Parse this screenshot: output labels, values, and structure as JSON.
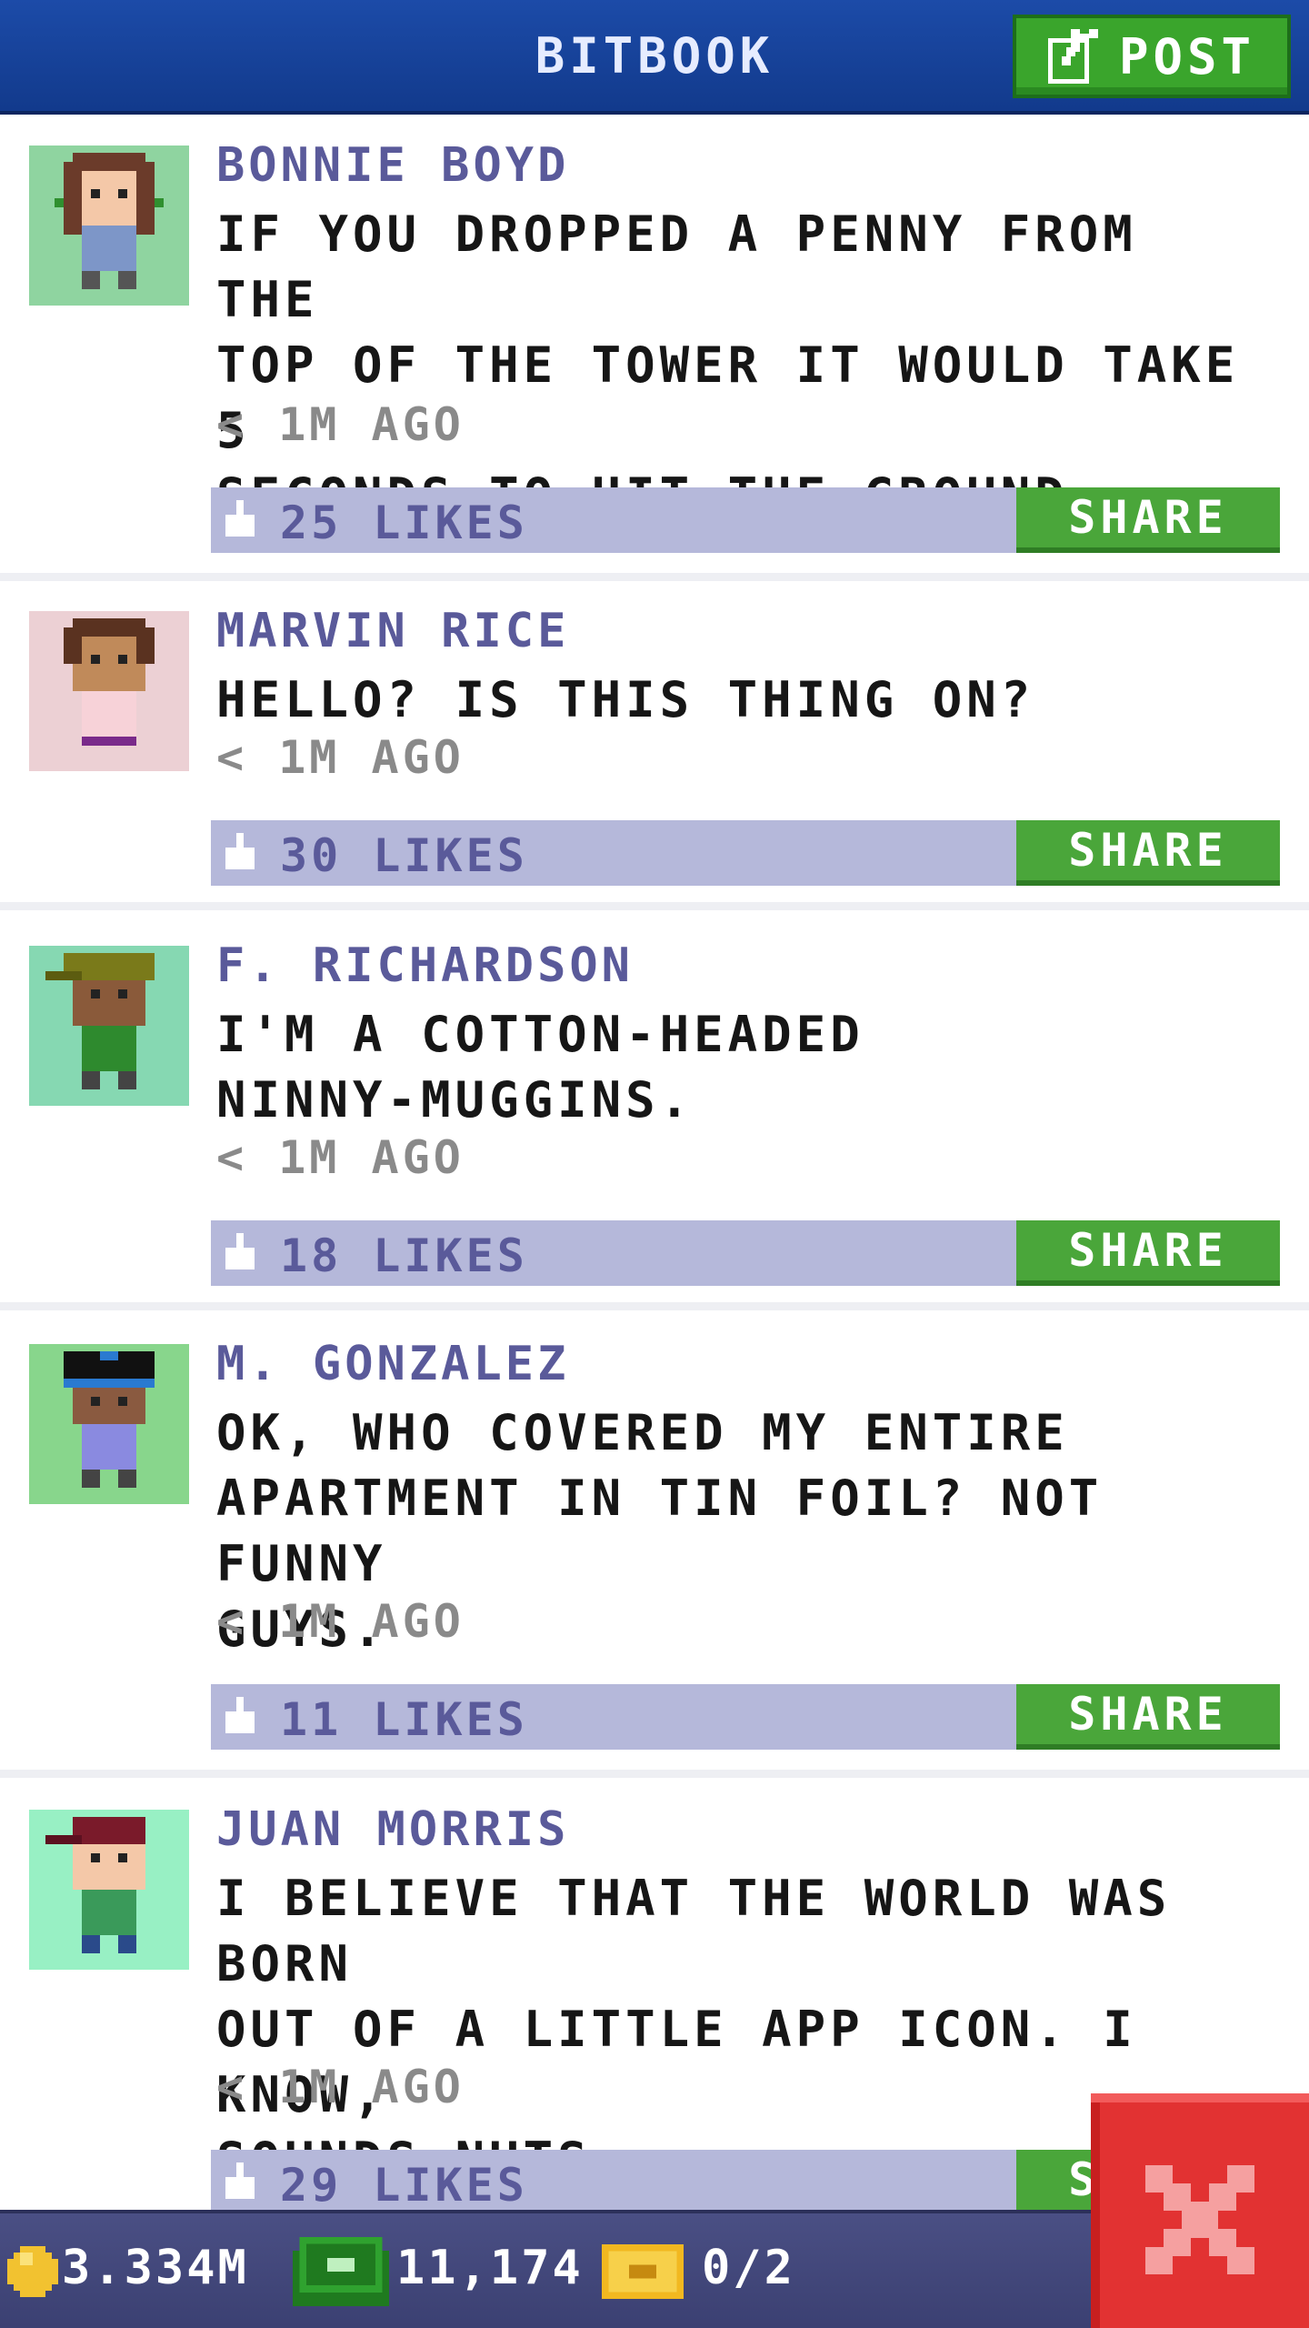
{
  "header": {
    "title": "BITBOOK",
    "post_label": "POST"
  },
  "colors": {
    "header_blue": "#1c4ba8",
    "post_green": "#3aa52c",
    "likes_bar": "#b5b8da",
    "share_green": "#4aa63a",
    "name_purple": "#5a5a9a",
    "close_red": "#e23232"
  },
  "posts": [
    {
      "name": "BONNIE BOYD",
      "message": "IF YOU DROPPED A PENNY FROM THE\nTOP OF THE TOWER IT WOULD TAKE 5\nSECONDS TO HIT THE GROUND.",
      "time": "< 1M AGO",
      "likes": "25 LIKES",
      "share": "SHARE",
      "avatar_bg": "#8fd4a0"
    },
    {
      "name": "MARVIN RICE",
      "message": "HELLO? IS THIS THING ON?",
      "time": "< 1M AGO",
      "likes": "30 LIKES",
      "share": "SHARE",
      "avatar_bg": "#ecd0d4"
    },
    {
      "name": "F. RICHARDSON",
      "message": "I'M A COTTON-HEADED\nNINNY-MUGGINS.",
      "time": "< 1M AGO",
      "likes": "18 LIKES",
      "share": "SHARE",
      "avatar_bg": "#86d8b2"
    },
    {
      "name": "M. GONZALEZ",
      "message": "OK, WHO COVERED MY ENTIRE\nAPARTMENT IN TIN FOIL? NOT FUNNY\nGUYS.",
      "time": "< 1M AGO",
      "likes": "11 LIKES",
      "share": "SHARE",
      "avatar_bg": "#88d68c"
    },
    {
      "name": "JUAN MORRIS",
      "message": "I BELIEVE THAT THE WORLD WAS BORN\nOUT OF A LITTLE APP ICON. I KNOW,\nSOUNDS NUTS.",
      "time": "< 1M AGO",
      "likes": "29 LIKES",
      "share": "SHARE",
      "avatar_bg": "#98f0c4"
    }
  ],
  "bottom_bar": {
    "coins": "3.334M",
    "bux": "11,174",
    "tickets": "0/2"
  },
  "icons": [
    "edit-icon",
    "like-icon",
    "coin-icon",
    "cash-icon",
    "ticket-icon",
    "close-icon"
  ]
}
